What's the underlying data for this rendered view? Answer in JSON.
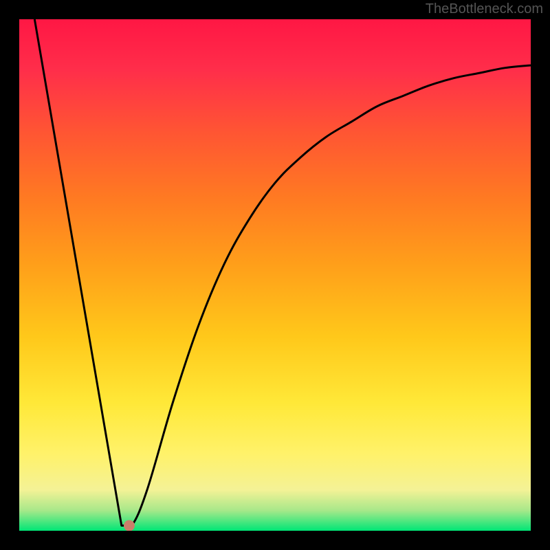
{
  "watermark": "TheBottleneck.com",
  "chart_data": {
    "type": "line",
    "title": "",
    "xlabel": "",
    "ylabel": "",
    "xlim": [
      0,
      100
    ],
    "ylim": [
      0,
      100
    ],
    "background_gradient": [
      "#ff1744",
      "#ff5722",
      "#ff9800",
      "#ffc107",
      "#ffeb3b",
      "#fdd835",
      "#cddc39",
      "#8bc34a",
      "#00e676"
    ],
    "series": [
      {
        "name": "bottleneck-curve",
        "type": "line",
        "color": "#000000",
        "points": [
          {
            "x": 3,
            "y": 100
          },
          {
            "x": 20,
            "y": 1
          },
          {
            "x": 22,
            "y": 1
          },
          {
            "x": 25,
            "y": 8
          },
          {
            "x": 30,
            "y": 25
          },
          {
            "x": 35,
            "y": 40
          },
          {
            "x": 40,
            "y": 52
          },
          {
            "x": 45,
            "y": 61
          },
          {
            "x": 50,
            "y": 68
          },
          {
            "x": 55,
            "y": 73
          },
          {
            "x": 60,
            "y": 77
          },
          {
            "x": 65,
            "y": 80
          },
          {
            "x": 70,
            "y": 83
          },
          {
            "x": 75,
            "y": 85
          },
          {
            "x": 80,
            "y": 87
          },
          {
            "x": 85,
            "y": 88.5
          },
          {
            "x": 90,
            "y": 89.5
          },
          {
            "x": 95,
            "y": 90.5
          },
          {
            "x": 100,
            "y": 91
          }
        ]
      }
    ],
    "marker": {
      "name": "optimal-point",
      "x": 21.5,
      "y": 1,
      "color": "#c97f6a",
      "radius": 8
    },
    "frame": {
      "color": "#000000",
      "stroke_width": 28
    }
  }
}
